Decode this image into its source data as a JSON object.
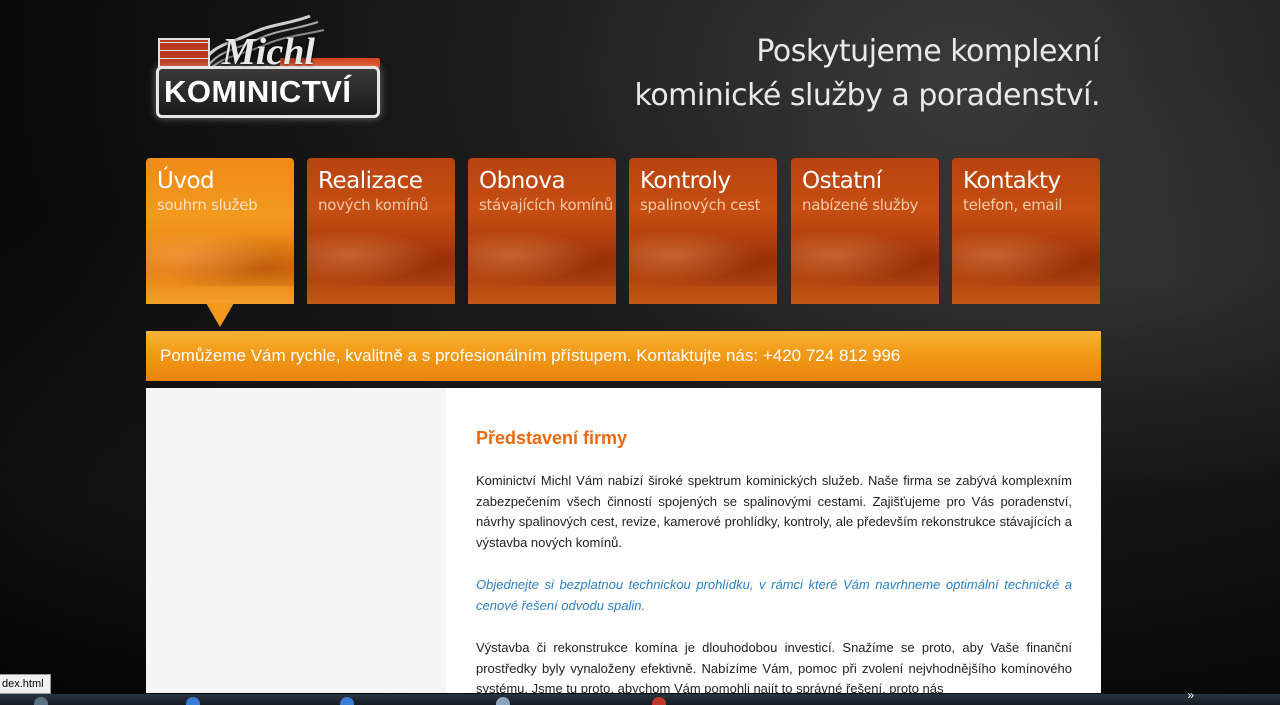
{
  "logo": {
    "script_text": "Michl",
    "brand_text": "KOMINICTVÍ"
  },
  "header": {
    "tagline_line1": "Poskytujeme komplexní",
    "tagline_line2": "kominické služby a poradenství."
  },
  "nav": {
    "tabs": [
      {
        "title": "Úvod",
        "subtitle": "souhrn služeb",
        "active": true
      },
      {
        "title": "Realizace",
        "subtitle": "nových komínů",
        "active": false
      },
      {
        "title": "Obnova",
        "subtitle": "stávajících komínů",
        "active": false
      },
      {
        "title": "Kontroly",
        "subtitle": "spalinových cest",
        "active": false
      },
      {
        "title": "Ostatní",
        "subtitle": "nabízené služby",
        "active": false
      },
      {
        "title": "Kontakty",
        "subtitle": "telefon, email",
        "active": false
      }
    ]
  },
  "banner": {
    "text": "Pomůžeme Vám rychle, kvalitně a s profesionálním přístupem. Kontaktujte nás: +420 724 812 996"
  },
  "main": {
    "heading": "Představení firmy",
    "paragraph1": "Kominictví Michl Vám nabízí široké spektrum kominických služeb. Naše firma se zabývá komplexním zabezpečením všech činností spojených se spalinovými cestami. Zajišťujeme pro Vás poradenství, návrhy spalinových cest, revize, kamerové prohlídky, kontroly, ale především rekonstrukce stávajících a výstavba nových komínů.",
    "paragraph2": "Objednejte si bezplatnou technickou prohlídku, v rámci které Vám navrhneme optimální technické a cenové řešení odvodu spalin.",
    "paragraph3": "Výstavba či rekonstrukce komína je dlouhodobou investicí. Snažíme se proto, aby Vaše finanční prostředky byly vynaloženy efektivně. Nabízíme Vám, pomoc při zvolení nejvhodnějšího komínového systému. Jsme tu proto, abychom Vám pomohli najít to správné řešení, proto nás"
  },
  "status": {
    "url_text": "dex.html"
  },
  "taskbar": {
    "chevron": "»"
  },
  "colors": {
    "accent_orange": "#f29a17",
    "heading_orange": "#e96a0c",
    "link_blue": "#2b7fc5",
    "tab_dark": "#b8430f"
  }
}
